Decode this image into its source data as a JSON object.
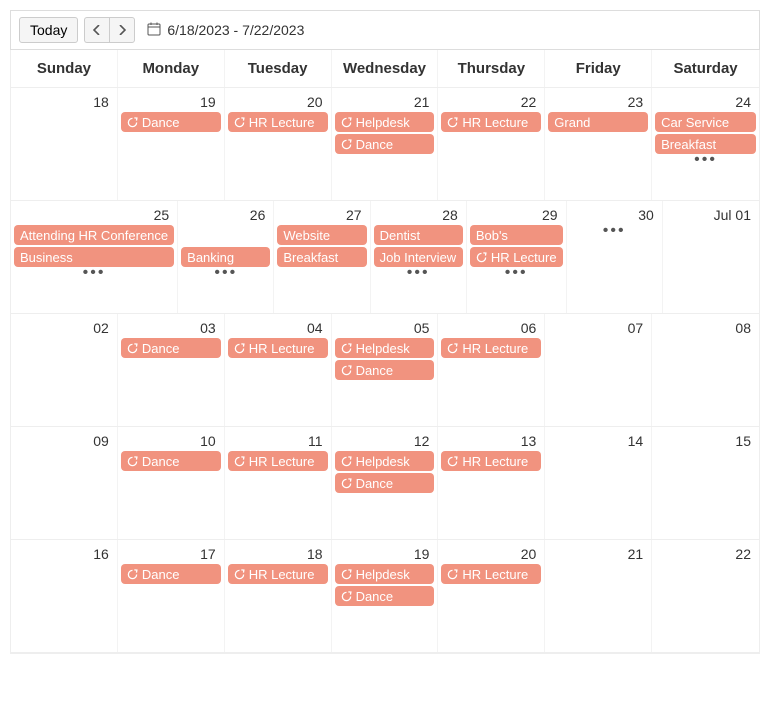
{
  "toolbar": {
    "today_label": "Today",
    "date_range": "6/18/2023 - 7/22/2023"
  },
  "day_names": [
    "Sunday",
    "Monday",
    "Tuesday",
    "Wednesday",
    "Thursday",
    "Friday",
    "Saturday"
  ],
  "weeks": [
    {
      "days": [
        {
          "num": "18",
          "events": [],
          "more": false
        },
        {
          "num": "19",
          "events": [
            {
              "title": "Dance",
              "recur": true
            }
          ],
          "more": false
        },
        {
          "num": "20",
          "events": [
            {
              "title": "HR Lecture",
              "recur": true
            }
          ],
          "more": false
        },
        {
          "num": "21",
          "events": [
            {
              "title": "Helpdesk",
              "recur": true
            },
            {
              "title": "Dance",
              "recur": true
            }
          ],
          "more": false
        },
        {
          "num": "22",
          "events": [
            {
              "title": "HR Lecture",
              "recur": true
            }
          ],
          "more": false
        },
        {
          "num": "23",
          "events": [
            {
              "title": "Grand",
              "recur": false
            }
          ],
          "more": false
        },
        {
          "num": "24",
          "events": [
            {
              "title": "Car Service",
              "recur": false
            },
            {
              "title": "Breakfast",
              "recur": false
            }
          ],
          "more": true
        }
      ]
    },
    {
      "days": [
        {
          "num": "25",
          "events": [
            {
              "title": "Attending HR Conference",
              "recur": false
            },
            {
              "title": "Business",
              "recur": false
            }
          ],
          "more": true
        },
        {
          "num": "26",
          "events": [
            {
              "title": "",
              "placeholder": true
            },
            {
              "title": "Banking",
              "recur": false
            }
          ],
          "more": true
        },
        {
          "num": "27",
          "events": [
            {
              "title": "Website",
              "recur": false
            },
            {
              "title": "Breakfast",
              "recur": false
            }
          ],
          "more": false
        },
        {
          "num": "28",
          "events": [
            {
              "title": "Dentist",
              "recur": false
            },
            {
              "title": "Job Interview",
              "recur": false
            }
          ],
          "more": true
        },
        {
          "num": "29",
          "events": [
            {
              "title": "Bob's",
              "recur": false
            },
            {
              "title": "HR Lecture",
              "recur": true
            }
          ],
          "more": true
        },
        {
          "num": "30",
          "events": [],
          "more": true
        },
        {
          "num": "Jul 01",
          "events": [],
          "more": false
        }
      ]
    },
    {
      "days": [
        {
          "num": "02",
          "events": [],
          "more": false
        },
        {
          "num": "03",
          "events": [
            {
              "title": "Dance",
              "recur": true
            }
          ],
          "more": false
        },
        {
          "num": "04",
          "events": [
            {
              "title": "HR Lecture",
              "recur": true
            }
          ],
          "more": false
        },
        {
          "num": "05",
          "events": [
            {
              "title": "Helpdesk",
              "recur": true
            },
            {
              "title": "Dance",
              "recur": true
            }
          ],
          "more": false
        },
        {
          "num": "06",
          "events": [
            {
              "title": "HR Lecture",
              "recur": true
            }
          ],
          "more": false
        },
        {
          "num": "07",
          "events": [],
          "more": false
        },
        {
          "num": "08",
          "events": [],
          "more": false
        }
      ]
    },
    {
      "days": [
        {
          "num": "09",
          "events": [],
          "more": false
        },
        {
          "num": "10",
          "events": [
            {
              "title": "Dance",
              "recur": true
            }
          ],
          "more": false
        },
        {
          "num": "11",
          "events": [
            {
              "title": "HR Lecture",
              "recur": true
            }
          ],
          "more": false
        },
        {
          "num": "12",
          "events": [
            {
              "title": "Helpdesk",
              "recur": true
            },
            {
              "title": "Dance",
              "recur": true
            }
          ],
          "more": false
        },
        {
          "num": "13",
          "events": [
            {
              "title": "HR Lecture",
              "recur": true
            }
          ],
          "more": false
        },
        {
          "num": "14",
          "events": [],
          "more": false
        },
        {
          "num": "15",
          "events": [],
          "more": false
        }
      ]
    },
    {
      "days": [
        {
          "num": "16",
          "events": [],
          "more": false
        },
        {
          "num": "17",
          "events": [
            {
              "title": "Dance",
              "recur": true
            }
          ],
          "more": false
        },
        {
          "num": "18",
          "events": [
            {
              "title": "HR Lecture",
              "recur": true
            }
          ],
          "more": false
        },
        {
          "num": "19",
          "events": [
            {
              "title": "Helpdesk",
              "recur": true
            },
            {
              "title": "Dance",
              "recur": true
            }
          ],
          "more": false
        },
        {
          "num": "20",
          "events": [
            {
              "title": "HR Lecture",
              "recur": true
            }
          ],
          "more": false
        },
        {
          "num": "21",
          "events": [],
          "more": false
        },
        {
          "num": "22",
          "events": [],
          "more": false
        }
      ]
    }
  ],
  "more_label": "•••"
}
